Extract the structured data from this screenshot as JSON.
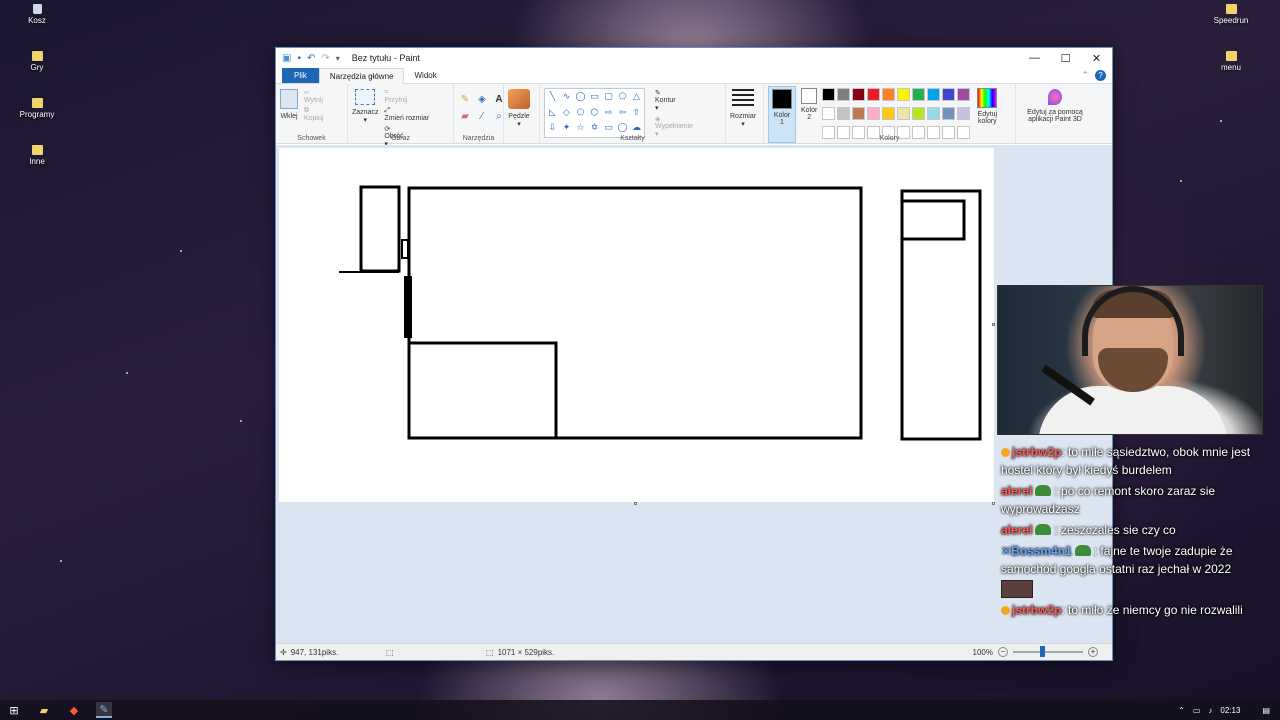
{
  "desktop": {
    "icons_left": [
      {
        "label": "Kosz",
        "icon": "recycle-bin-icon"
      },
      {
        "label": "Gry",
        "icon": "folder-icon"
      },
      {
        "label": "Programy",
        "icon": "folder-icon"
      },
      {
        "label": "Inne",
        "icon": "folder-icon"
      }
    ],
    "icons_right": [
      {
        "label": "Speedrun",
        "icon": "folder-icon"
      },
      {
        "label": "menu",
        "icon": "folder-icon"
      }
    ]
  },
  "window": {
    "title": "Bez tytułu - Paint",
    "tabs": {
      "file": "Plik",
      "home": "Narzędzia główne",
      "view": "Widok"
    },
    "ribbon": {
      "clipboard": {
        "label": "Schowek",
        "paste": "Wklej",
        "cut": "Wytnij",
        "copy": "Kopiuj"
      },
      "image": {
        "label": "Obraz",
        "select": "Zaznacz",
        "crop": "Przytnij",
        "resize": "Zmień rozmiar",
        "rotate": "Obróć"
      },
      "tools": {
        "label": "Narzędzia"
      },
      "brushes": {
        "label": "Pędzle"
      },
      "shapes": {
        "label": "Kształty",
        "outline": "Kontur",
        "fill": "Wypełnienie"
      },
      "size": {
        "label": "Rozmiar"
      },
      "color1": {
        "label_a": "Kolor",
        "label_b": "1",
        "value": "#000000"
      },
      "color2": {
        "label_a": "Kolor",
        "label_b": "2",
        "value": "#ffffff"
      },
      "colors": {
        "label": "Kolory",
        "edit": "Edytuj kolory",
        "palette": [
          "#000000",
          "#7f7f7f",
          "#880015",
          "#ed1c24",
          "#ff7f27",
          "#fff200",
          "#22b14c",
          "#00a2e8",
          "#3f48cc",
          "#a349a4",
          "#ffffff",
          "#c3c3c3",
          "#b97a57",
          "#ffaec9",
          "#ffc90e",
          "#efe4b0",
          "#b5e61d",
          "#99d9ea",
          "#7092be",
          "#c8bfe7",
          "#ffffff",
          "#ffffff",
          "#ffffff",
          "#ffffff",
          "#ffffff",
          "#ffffff",
          "#ffffff",
          "#ffffff",
          "#ffffff",
          "#ffffff"
        ]
      },
      "paint3d": "Edytuj za pomocą aplikacji Paint 3D"
    },
    "status": {
      "cursor_pos": "947, 131piks.",
      "image_size": "1071 × 529piks.",
      "zoom": "100%"
    }
  },
  "chat": {
    "messages": [
      {
        "user": "jstrbw2p",
        "color": "#ff5c5c",
        "text": ": to miłe sąsiedztwo, obok mnie jest hostel który był kiedyś burdelem"
      },
      {
        "user": "alerel",
        "color": "#ff5c5c",
        "text": ": po co remont skoro zaraz sie wyprowadzasz"
      },
      {
        "user": "alerel",
        "color": "#ff5c5c",
        "text": ": zeszczales sie czy co"
      },
      {
        "user": "Bossm4n1",
        "color": "#5aa9ff",
        "text": ": fajne te twoje zadupie że samochód googla ostatni raz jechał w 2022"
      },
      {
        "user": "jstrbw2p",
        "color": "#ff5c5c",
        "text": ": to miło że niemcy go nie rozwalili"
      }
    ]
  },
  "taskbar": {
    "time": "02:13"
  }
}
